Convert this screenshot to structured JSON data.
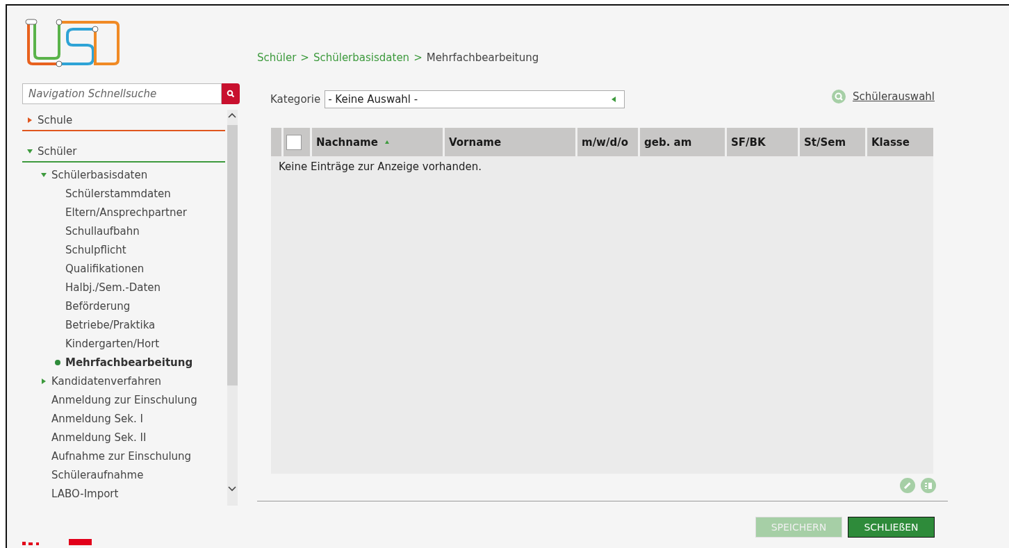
{
  "search": {
    "placeholder": "Navigation Schnellsuche"
  },
  "navigation": [
    {
      "label": "Schule",
      "expanded": false,
      "color": "#e0561e"
    },
    {
      "label": "Schüler",
      "expanded": true,
      "color": "#3d9a3d",
      "children": [
        {
          "label": "Schülerbasisdaten",
          "expanded": true,
          "children": [
            {
              "label": "Schülerstammdaten",
              "selected": false
            },
            {
              "label": "Eltern/Ansprechpartner",
              "selected": false
            },
            {
              "label": "Schullaufbahn",
              "selected": false
            },
            {
              "label": "Schulpflicht",
              "selected": false
            },
            {
              "label": "Qualifikationen",
              "selected": false
            },
            {
              "label": "Halbj./Sem.-Daten",
              "selected": false
            },
            {
              "label": "Beförderung",
              "selected": false
            },
            {
              "label": "Betriebe/Praktika",
              "selected": false
            },
            {
              "label": "Kindergarten/Hort",
              "selected": false
            },
            {
              "label": "Mehrfachbearbeitung",
              "selected": true
            }
          ]
        },
        {
          "label": "Kandidatenverfahren",
          "expanded": false
        },
        {
          "label": "Anmeldung zur Einschulung",
          "selected": false
        },
        {
          "label": "Anmeldung Sek. I",
          "selected": false
        },
        {
          "label": "Anmeldung Sek. II",
          "selected": false
        },
        {
          "label": "Aufnahme zur Einschulung",
          "selected": false
        },
        {
          "label": "Schüleraufnahme",
          "selected": false
        },
        {
          "label": "LABO-Import",
          "selected": false
        }
      ]
    }
  ],
  "breadcrumb": [
    {
      "label": "Schüler",
      "link": true
    },
    {
      "label": "Schülerbasisdaten",
      "link": true
    },
    {
      "label": "Mehrfachbearbeitung",
      "link": false
    }
  ],
  "breadcrumb_separator": ">",
  "category": {
    "label": "Kategorie",
    "value": "- Keine Auswahl -"
  },
  "student_selection_link": "Schülerauswahl",
  "table": {
    "select_all_checked": false,
    "columns": [
      {
        "label": "Nachname",
        "sorted": true
      },
      {
        "label": "Vorname",
        "sorted": false
      },
      {
        "label": "m/w/d/o",
        "sorted": false
      },
      {
        "label": "geb. am",
        "sorted": false
      },
      {
        "label": "SF/BK",
        "sorted": false
      },
      {
        "label": "St/Sem",
        "sorted": false
      },
      {
        "label": "Klasse",
        "sorted": false
      }
    ],
    "empty_message": "Keine Einträge zur Anzeige vorhanden."
  },
  "buttons": [
    {
      "label": "SPEICHERN",
      "disabled": true
    },
    {
      "label": "SCHLIEßEN",
      "disabled": false
    }
  ]
}
